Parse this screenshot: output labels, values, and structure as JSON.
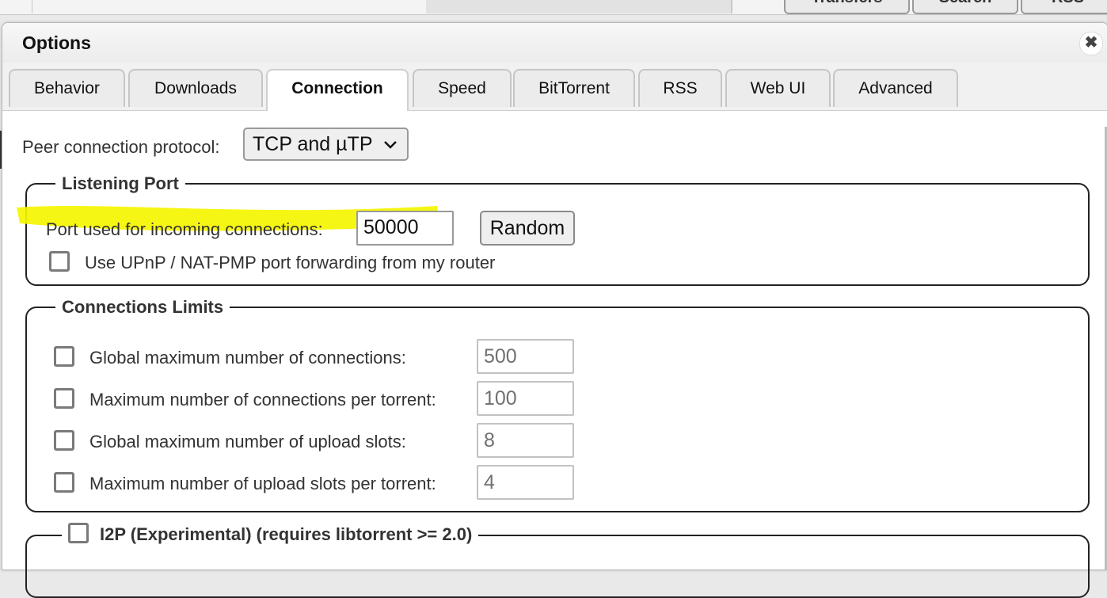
{
  "background": {
    "tabs": [
      {
        "label": "Transfers"
      },
      {
        "label": "Search"
      },
      {
        "label": "RSS"
      }
    ]
  },
  "dialog": {
    "title": "Options",
    "close_glyph": "✖",
    "tabs": [
      {
        "label": "Behavior"
      },
      {
        "label": "Downloads"
      },
      {
        "label": "Connection",
        "active": true
      },
      {
        "label": "Speed"
      },
      {
        "label": "BitTorrent"
      },
      {
        "label": "RSS"
      },
      {
        "label": "Web UI"
      },
      {
        "label": "Advanced"
      }
    ]
  },
  "connection": {
    "protocol_label": "Peer connection protocol:",
    "protocol_value": "TCP and µTP",
    "listening_port": {
      "legend": "Listening Port",
      "port_label": "Port used for incoming connections:",
      "port_value": "50000",
      "random_button": "Random",
      "upnp_label": "Use UPnP / NAT-PMP port forwarding from my router",
      "upnp_checked": false
    },
    "limits": {
      "legend": "Connections Limits",
      "rows": [
        {
          "label": "Global maximum number of connections:",
          "value": "500",
          "checked": false
        },
        {
          "label": "Maximum number of connections per torrent:",
          "value": "100",
          "checked": false
        },
        {
          "label": "Global maximum number of upload slots:",
          "value": "8",
          "checked": false
        },
        {
          "label": "Maximum number of upload slots per torrent:",
          "value": "4",
          "checked": false
        }
      ]
    },
    "i2p": {
      "legend": "I2P (Experimental) (requires libtorrent >= 2.0)",
      "checked": false
    }
  },
  "colors": {
    "annotation_highlight": "#f5f500",
    "dialog_background": "#ffffff",
    "tab_background": "#ececec"
  }
}
